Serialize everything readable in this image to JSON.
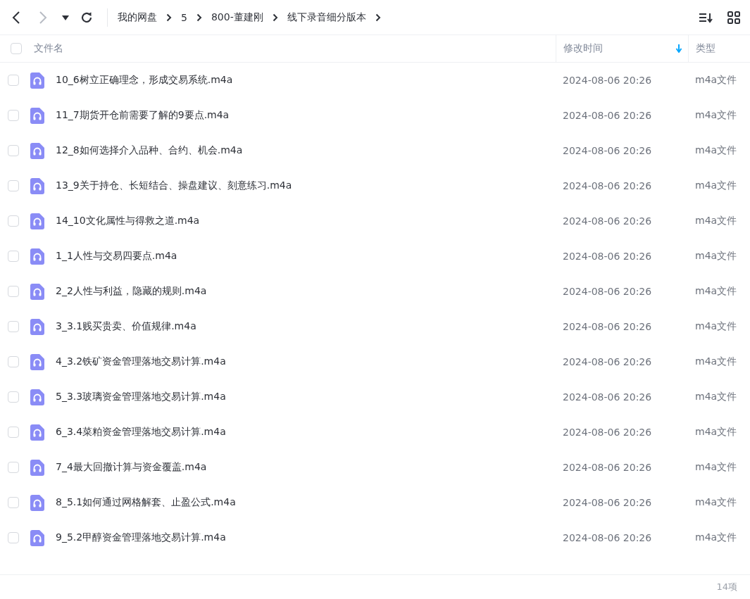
{
  "nav": {
    "back": {
      "disabled": false
    },
    "forward": {
      "disabled": true
    }
  },
  "breadcrumb": [
    "我的网盘",
    "5",
    "800-董建刚",
    "线下录音细分版本"
  ],
  "table": {
    "select_all": {
      "checked": false
    },
    "columns": [
      {
        "label": "文件名",
        "sorted": false
      },
      {
        "label": "修改时间",
        "sorted": true
      },
      {
        "label": "类型",
        "sorted": false
      }
    ],
    "rows": [
      {
        "name": "10_6树立正确理念，形成交易系统.m4a",
        "modified": "2024-08-06 20:26",
        "type": "m4a文件",
        "checked": false
      },
      {
        "name": "11_7期货开仓前需要了解的9要点.m4a",
        "modified": "2024-08-06 20:26",
        "type": "m4a文件",
        "checked": false
      },
      {
        "name": "12_8如何选择介入品种、合约、机会.m4a",
        "modified": "2024-08-06 20:26",
        "type": "m4a文件",
        "checked": false
      },
      {
        "name": "13_9关于持仓、长短结合、操盘建议、刻意练习.m4a",
        "modified": "2024-08-06 20:26",
        "type": "m4a文件",
        "checked": false
      },
      {
        "name": "14_10文化属性与得救之道.m4a",
        "modified": "2024-08-06 20:26",
        "type": "m4a文件",
        "checked": false
      },
      {
        "name": "1_1人性与交易四要点.m4a",
        "modified": "2024-08-06 20:26",
        "type": "m4a文件",
        "checked": false
      },
      {
        "name": "2_2人性与利益，隐藏的规则.m4a",
        "modified": "2024-08-06 20:26",
        "type": "m4a文件",
        "checked": false
      },
      {
        "name": "3_3.1贱买贵卖、价值规律.m4a",
        "modified": "2024-08-06 20:26",
        "type": "m4a文件",
        "checked": false
      },
      {
        "name": "4_3.2铁矿资金管理落地交易计算.m4a",
        "modified": "2024-08-06 20:26",
        "type": "m4a文件",
        "checked": false
      },
      {
        "name": "5_3.3玻璃资金管理落地交易计算.m4a",
        "modified": "2024-08-06 20:26",
        "type": "m4a文件",
        "checked": false
      },
      {
        "name": "6_3.4菜粕资金管理落地交易计算.m4a",
        "modified": "2024-08-06 20:26",
        "type": "m4a文件",
        "checked": false
      },
      {
        "name": "7_4最大回撤计算与资金覆盖.m4a",
        "modified": "2024-08-06 20:26",
        "type": "m4a文件",
        "checked": false
      },
      {
        "name": "8_5.1如何通过网格解套、止盈公式.m4a",
        "modified": "2024-08-06 20:26",
        "type": "m4a文件",
        "checked": false
      },
      {
        "name": "9_5.2甲醇资金管理落地交易计算.m4a",
        "modified": "2024-08-06 20:26",
        "type": "m4a文件",
        "checked": false
      }
    ]
  },
  "status_bar": {
    "count": "14项"
  }
}
